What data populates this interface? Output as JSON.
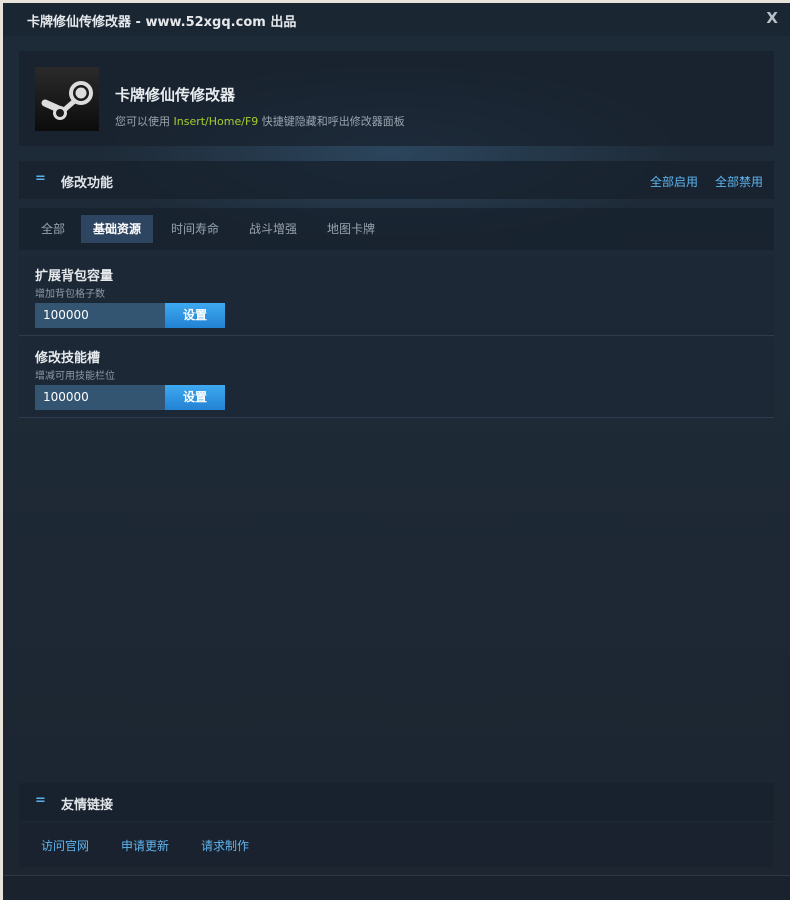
{
  "window": {
    "title": "卡牌修仙传修改器 - www.52xgq.com 出品",
    "close_label": "X"
  },
  "header": {
    "app_name": "卡牌修仙传修改器",
    "hint_prefix": "您可以使用 ",
    "hotkey": "Insert/Home/F9",
    "hint_suffix": " 快捷键隐藏和呼出修改器面板",
    "logo_icon": "steam-logo-icon",
    "hotkey_color": "#a3cf2f"
  },
  "features": {
    "marker": "=",
    "title": "修改功能",
    "enable_all": "全部启用",
    "disable_all": "全部禁用"
  },
  "tabs": [
    {
      "label": "全部",
      "active": false
    },
    {
      "label": "基础资源",
      "active": true
    },
    {
      "label": "时间寿命",
      "active": false
    },
    {
      "label": "战斗增强",
      "active": false
    },
    {
      "label": "地图卡牌",
      "active": false
    }
  ],
  "items": [
    {
      "title": "扩展背包容量",
      "desc": "增加背包格子数",
      "value": "100000",
      "button": "设置"
    },
    {
      "title": "修改技能槽",
      "desc": "增减可用技能栏位",
      "value": "100000",
      "button": "设置"
    }
  ],
  "links": {
    "marker": "=",
    "title": "友情链接",
    "items": [
      "访问官网",
      "申请更新",
      "请求制作"
    ]
  },
  "colors": {
    "accent": "#5fb4ee",
    "button": "#2a95e0",
    "active_tab": "#2d4560"
  }
}
